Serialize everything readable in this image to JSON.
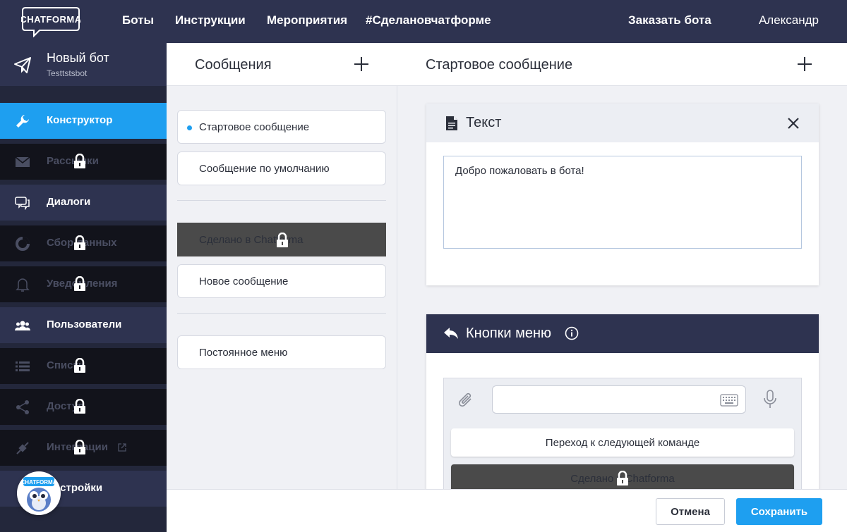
{
  "topnav": {
    "logo_text": "CHATFORMA",
    "items": [
      "Боты",
      "Инструкции",
      "Мероприятия",
      "#Сделановчатформе"
    ],
    "order_bot": "Заказать бота",
    "user": "Александр"
  },
  "bot": {
    "name": "Новый бот",
    "handle": "Testtstsbot"
  },
  "sidebar": {
    "items": [
      {
        "label": "Конструктор",
        "icon": "wrench-icon",
        "state": "active"
      },
      {
        "label": "Рассылки",
        "icon": "envelope-icon",
        "state": "locked"
      },
      {
        "label": "Диалоги",
        "icon": "chat-icon",
        "state": "normal"
      },
      {
        "label": "Сбор данных",
        "icon": "donut-icon",
        "state": "locked"
      },
      {
        "label": "Уведомления",
        "icon": "bell-icon",
        "state": "locked"
      },
      {
        "label": "Пользователи",
        "icon": "users-icon",
        "state": "normal"
      },
      {
        "label": "Списки",
        "icon": "list-icon",
        "state": "locked"
      },
      {
        "label": "Доступ",
        "icon": "share-icon",
        "state": "locked"
      },
      {
        "label": "Интеграции",
        "icon": "plug-icon",
        "state": "locked"
      },
      {
        "label": "Настройки",
        "icon": "gear-icon",
        "state": "normal"
      }
    ],
    "avatar_text": "CHATFORMA"
  },
  "messages": {
    "title": "Сообщения",
    "items": [
      {
        "label": "Стартовое сообщение"
      },
      {
        "label": "Сообщение по умолчанию"
      },
      {
        "label": "Сделано в Chatforma"
      },
      {
        "label": "Новое сообщение"
      },
      {
        "label": "Постоянное меню"
      }
    ]
  },
  "editor": {
    "title": "Стартовое сообщение",
    "text_block": {
      "title": "Текст",
      "value": "Добро пожаловать в бота!"
    },
    "menu_block": {
      "title": "Кнопки меню",
      "buttons": [
        "Переход к следующей команде",
        "Сделано в Chatforma"
      ]
    }
  },
  "footer": {
    "cancel": "Отмена",
    "save": "Сохранить"
  },
  "colors": {
    "accent": "#1e9ff0",
    "nav": "#2e3350",
    "sidebar_dark": "#12131b"
  }
}
